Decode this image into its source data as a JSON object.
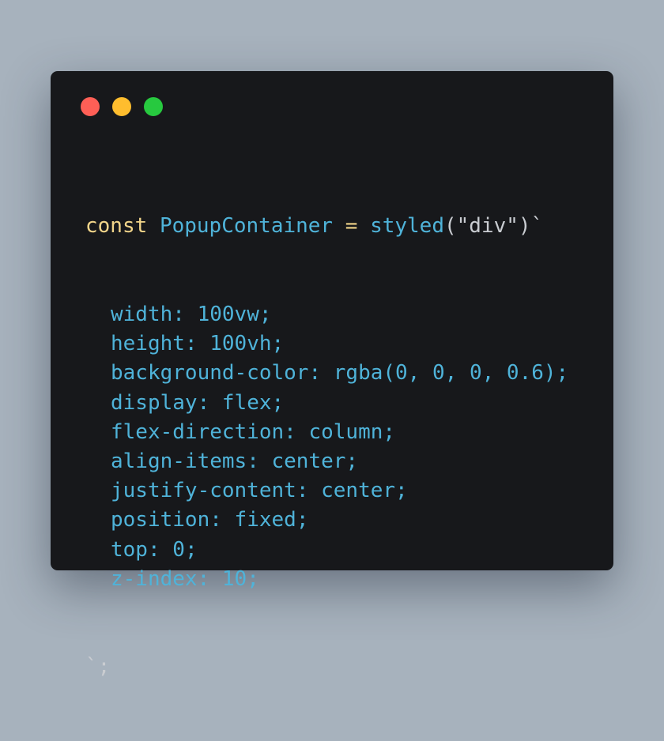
{
  "window": {
    "controls": [
      "close",
      "minimize",
      "maximize"
    ]
  },
  "code": {
    "line1": {
      "keyword": "const",
      "identifier": "PopupContainer",
      "operator": "=",
      "function": "styled",
      "open_paren": "(",
      "string": "\"div\"",
      "close_paren_tick": ")`"
    },
    "css": [
      {
        "prop": "width",
        "value": "100vw"
      },
      {
        "prop": "height",
        "value": "100vh"
      },
      {
        "prop": "background-color",
        "value": "rgba(0, 0, 0, 0.6)"
      },
      {
        "prop": "display",
        "value": "flex"
      },
      {
        "prop": "flex-direction",
        "value": "column"
      },
      {
        "prop": "align-items",
        "value": "center"
      },
      {
        "prop": "justify-content",
        "value": "center"
      },
      {
        "prop": "position",
        "value": "fixed"
      },
      {
        "prop": "top",
        "value": "0"
      },
      {
        "prop": "z-index",
        "value": "10"
      }
    ],
    "closing": "`;"
  },
  "colors": {
    "page_bg": "#a7b2bd",
    "window_bg": "#17181b",
    "close": "#ff5f56",
    "minimize": "#ffbd2e",
    "maximize": "#27c93f",
    "keyword": "#f2d58a",
    "identifier": "#4fb3d9",
    "punctuation": "#c9ccd1"
  }
}
